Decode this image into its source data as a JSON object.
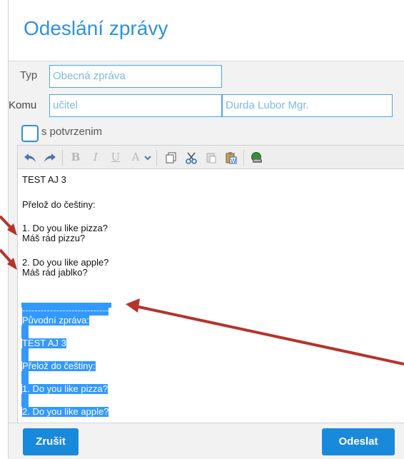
{
  "dialog": {
    "title": "Odeslání zprávy"
  },
  "form": {
    "type_label": "Typ",
    "type_value": "Obecná zpráva",
    "to_label": "Komu",
    "to_group": "učitel",
    "to_person": "Durda Lubor Mgr.",
    "confirm_label": "s potvrzenim"
  },
  "toolbar": {
    "items": [
      "undo-icon",
      "redo-icon",
      "bold-icon",
      "italic-icon",
      "underline-icon",
      "font-color-icon",
      "dropdown-icon",
      "copy-icon",
      "cut-icon",
      "paste-icon",
      "paste-word-icon",
      "insert-link-icon"
    ],
    "bold": "B",
    "italic": "I",
    "underline": "U",
    "font_color": "A"
  },
  "editor": {
    "lines": [
      "TEST AJ 3",
      "Přelož do češtiny:",
      "1. Do you like pizza?",
      "Máš rád pizzu?",
      "2. Do you like apple?",
      "Máš rád jablko?"
    ],
    "quoted_separator": "----------------------------",
    "quoted_header": "Původní zpráva:",
    "quoted_lines": [
      "TEST AJ 3",
      "Přelož do češtiny:",
      "1. Do you like pizza?",
      "2. Do you like apple?"
    ],
    "selection_color": "#3399ff"
  },
  "footer": {
    "cancel_label": "Zrušit",
    "send_label": "Odeslat"
  },
  "colors": {
    "accent": "#1989dc",
    "arrow": "#b5342b"
  }
}
